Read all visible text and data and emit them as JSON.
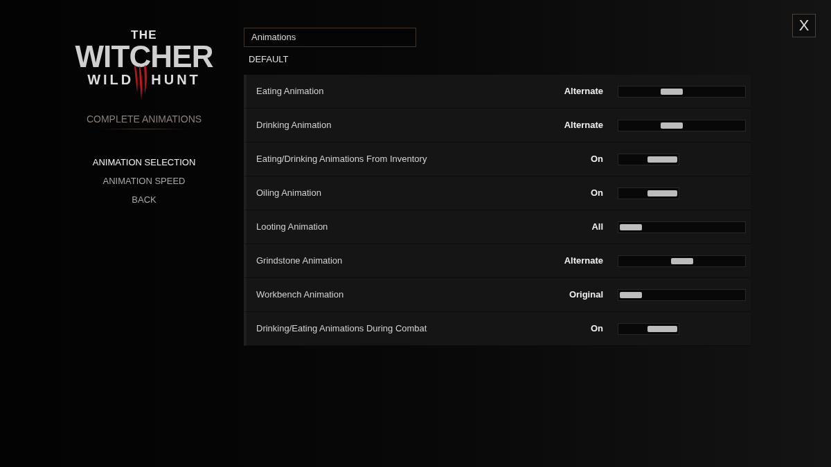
{
  "logo": {
    "top": "THE",
    "main": "WITCHER",
    "bottom_left": "WILD",
    "bottom_right": "HUNT"
  },
  "sidebar": {
    "title": "COMPLETE ANIMATIONS",
    "items": [
      {
        "label": "ANIMATION SELECTION",
        "selected": true
      },
      {
        "label": "ANIMATION SPEED",
        "selected": false
      },
      {
        "label": "BACK",
        "selected": false
      }
    ]
  },
  "category": {
    "title": "Animations"
  },
  "preset": "DEFAULT",
  "settings": [
    {
      "label": "Eating Animation",
      "value": "Alternate",
      "kind": "choice",
      "level": 0.4
    },
    {
      "label": "Drinking Animation",
      "value": "Alternate",
      "kind": "choice",
      "level": 0.4
    },
    {
      "label": "Eating/Drinking Animations From Inventory",
      "value": "On",
      "kind": "toggle",
      "on": true
    },
    {
      "label": "Oiling Animation",
      "value": "On",
      "kind": "toggle",
      "on": true
    },
    {
      "label": "Looting Animation",
      "value": "All",
      "kind": "choice",
      "level": 0
    },
    {
      "label": "Grindstone Animation",
      "value": "Alternate",
      "kind": "choice",
      "level": 0.5
    },
    {
      "label": "Workbench Animation",
      "value": "Original",
      "kind": "choice",
      "level": 0
    },
    {
      "label": "Drinking/Eating Animations During Combat",
      "value": "On",
      "kind": "toggle",
      "on": true
    }
  ],
  "close_button": {
    "label": "X"
  }
}
